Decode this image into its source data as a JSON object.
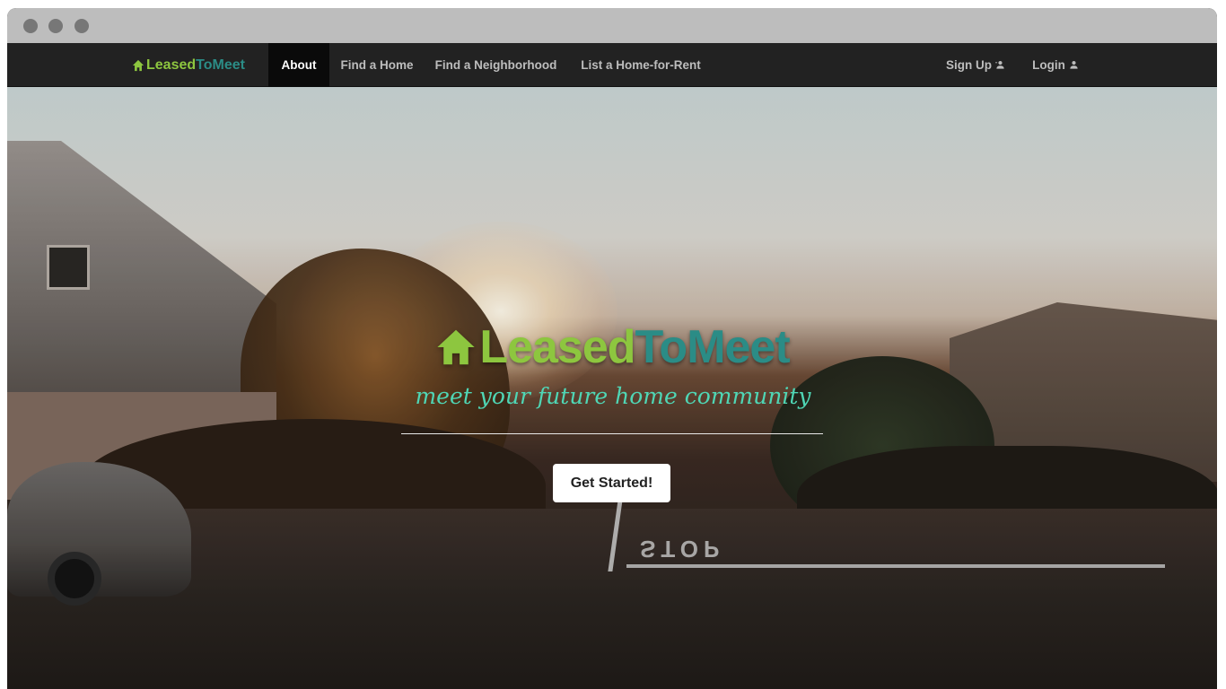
{
  "navbar": {
    "brand": {
      "part1": "LeasedTo",
      "part1_a": "Leased",
      "part1_b": "ToMeet",
      "icon": "home-icon"
    },
    "items": [
      {
        "label": "About",
        "active": true
      },
      {
        "label": "Find a Home",
        "active": false
      },
      {
        "label": "Find a Neighborhood",
        "active": false
      },
      {
        "label": "List a Home-for-Rent",
        "active": false
      }
    ],
    "signup_label": "Sign Up",
    "login_label": "Login",
    "user_icon": "user-icon"
  },
  "hero": {
    "logo_a": "Leased",
    "logo_b": "ToMeet",
    "tagline": "meet your future home community",
    "cta_label": "Get Started!",
    "road_marking": "STOP"
  },
  "colors": {
    "brand_green": "#8dc63f",
    "brand_teal": "#2b8c86",
    "tagline": "#4fd6b5",
    "navbar_bg": "#222222"
  }
}
